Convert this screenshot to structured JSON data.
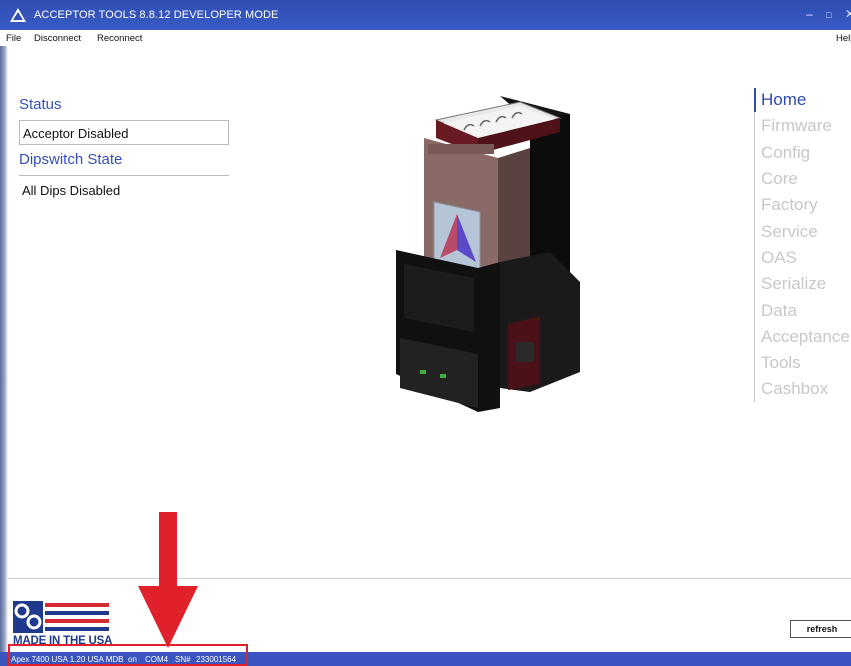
{
  "window": {
    "title": "ACCEPTOR TOOLS 8.8.12 DEVELOPER MODE",
    "minimize_glyph": "–",
    "maximize_glyph": "□",
    "close_glyph": "✕"
  },
  "menu": {
    "file": "File",
    "disconnect": "Disconnect",
    "reconnect": "Reconnect",
    "help": "Help"
  },
  "status_panel": {
    "status_heading": "Status",
    "status_value": "Acceptor Disabled",
    "dipswitch_heading": "Dipswitch State",
    "dipswitch_value": "All Dips Disabled"
  },
  "nav": {
    "items": [
      {
        "label": "Home",
        "active": true
      },
      {
        "label": "Firmware",
        "active": false
      },
      {
        "label": "Config",
        "active": false
      },
      {
        "label": "Core",
        "active": false
      },
      {
        "label": "Factory",
        "active": false
      },
      {
        "label": "Service",
        "active": false
      },
      {
        "label": "OAS",
        "active": false
      },
      {
        "label": "Serialize",
        "active": false
      },
      {
        "label": "Data",
        "active": false
      },
      {
        "label": "Acceptance",
        "active": false
      },
      {
        "label": "Tools",
        "active": false
      },
      {
        "label": "Cashbox",
        "active": false
      }
    ]
  },
  "footer": {
    "logo_text": "MADE IN THE USA",
    "refresh_label": "refresh"
  },
  "statusbar": {
    "model": "Apex 7400 USA 1.20 USA MDB",
    "on": "on",
    "port": "COM4",
    "sn_label": "SN#",
    "serial": "233001564"
  },
  "colors": {
    "accent": "#2f4aa8",
    "titlebar": "#3a55bf",
    "nav_inactive": "#c8c8c8",
    "annotation_red": "#e0202a"
  }
}
